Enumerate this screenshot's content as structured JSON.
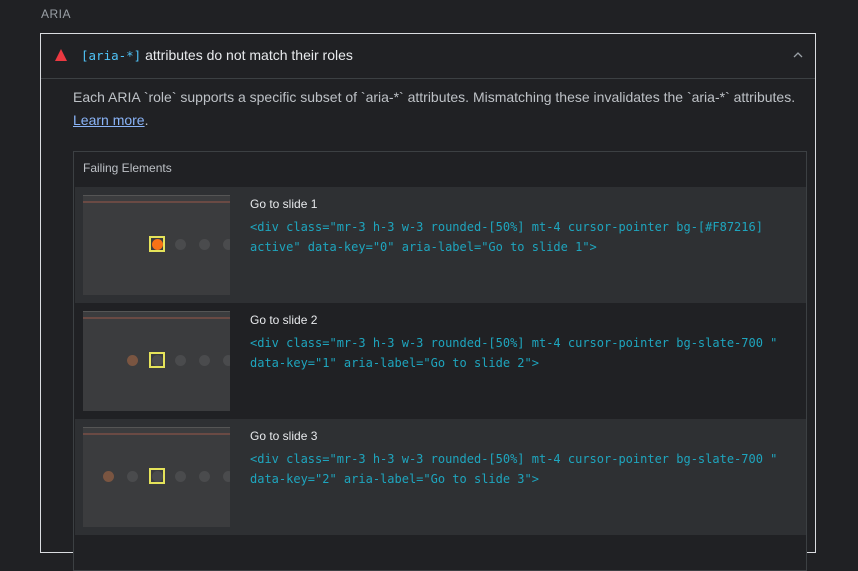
{
  "section_title": "ARIA",
  "audit": {
    "title_code": "[aria-*]",
    "title_text": " attributes do not match their roles",
    "description": "Each ARIA `role` supports a specific subset of `aria-*` attributes. Mismatching these invalidates the `aria-*` attributes.",
    "learn_more": "Learn more",
    "period": ".",
    "table_header": "Failing Elements",
    "colors": {
      "fail": "#eb3941",
      "active_dot": "#f87216",
      "highlight": "#e5e35a",
      "code": "#1ea5be"
    },
    "rows": [
      {
        "label": "Go to slide 1",
        "code": "<div class=\"mr-3 h-3 w-3 rounded-[50%] mt-4 cursor-pointer bg-[#F87216] active\" data-key=\"0\" aria-label=\"Go to slide 1\">"
      },
      {
        "label": "Go to slide 2",
        "code": "<div class=\"mr-3 h-3 w-3 rounded-[50%] mt-4 cursor-pointer bg-slate-700 \" data-key=\"1\" aria-label=\"Go to slide 2\">"
      },
      {
        "label": "Go to slide 3",
        "code": "<div class=\"mr-3 h-3 w-3 rounded-[50%] mt-4 cursor-pointer bg-slate-700 \" data-key=\"2\" aria-label=\"Go to slide 3\">"
      }
    ]
  },
  "icons": {
    "fail": "warning-triangle-icon",
    "collapse": "chevron-up-icon"
  }
}
